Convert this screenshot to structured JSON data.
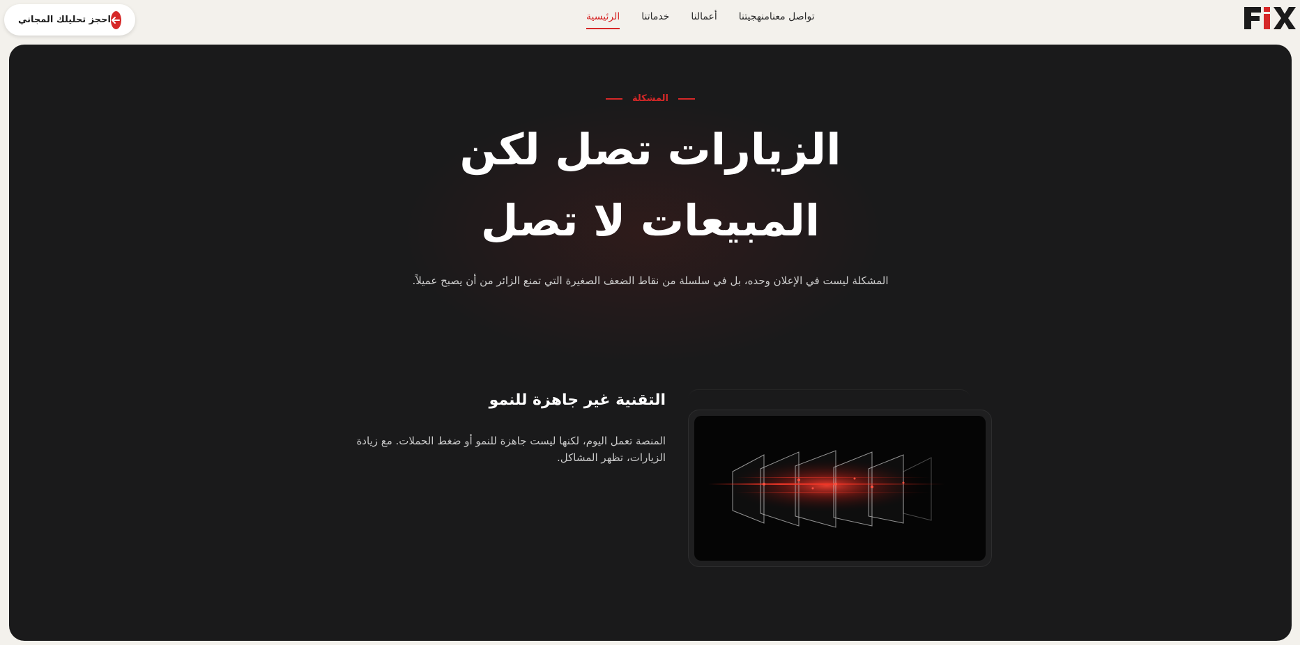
{
  "header": {
    "logo_text": "FiX",
    "nav": [
      {
        "label": "الرئيسية",
        "active": true
      },
      {
        "label": "خدماتنا",
        "active": false
      },
      {
        "label": "أعمالنا",
        "active": false
      },
      {
        "label": "منهجيتنا",
        "active": false
      },
      {
        "label": "تواصل معنا",
        "active": false
      }
    ],
    "cta_label": "احجز تحليلك المجاني",
    "cta_icon": "arrow-left-icon"
  },
  "hero": {
    "eyebrow": "المشكلة",
    "title_line1": "الزيارات تصل لكن",
    "title_line2": "المبيعات لا تصل",
    "subtitle": "المشكلة ليست في الإعلان وحده، بل في سلسلة من نقاط الضعف الصغيرة التي تمنع الزائر من أن يصبح عميلاً."
  },
  "feature": {
    "title": "التقنية غير جاهزة للنمو",
    "description": "المنصة تعمل اليوم، لكنها ليست جاهزة للنمو أو ضغط الحملات. مع زيادة الزيارات، تظهر المشاكل.",
    "image_icon": "glowing-layers-illustration"
  },
  "colors": {
    "accent": "#d62828",
    "panel": "#1a1a1b",
    "page": "#f3f1ec"
  }
}
